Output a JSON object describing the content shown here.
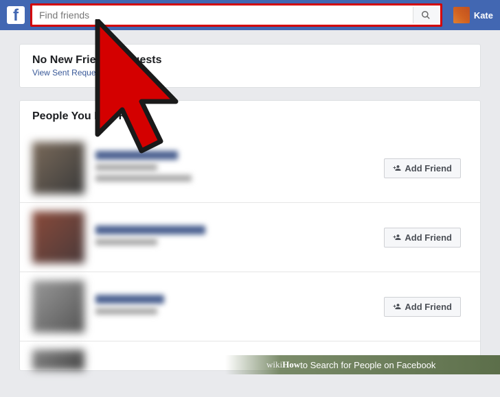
{
  "topbar": {
    "search_placeholder": "Find friends",
    "user_name": "Kate"
  },
  "requests": {
    "title": "No New Friend Requests",
    "link": "View Sent Requests"
  },
  "pymk": {
    "title": "People You May Know",
    "add_label": "Add Friend"
  },
  "footer": {
    "brand_wiki": "wiki",
    "brand_how": "How",
    "text": " to Search for People on Facebook"
  }
}
